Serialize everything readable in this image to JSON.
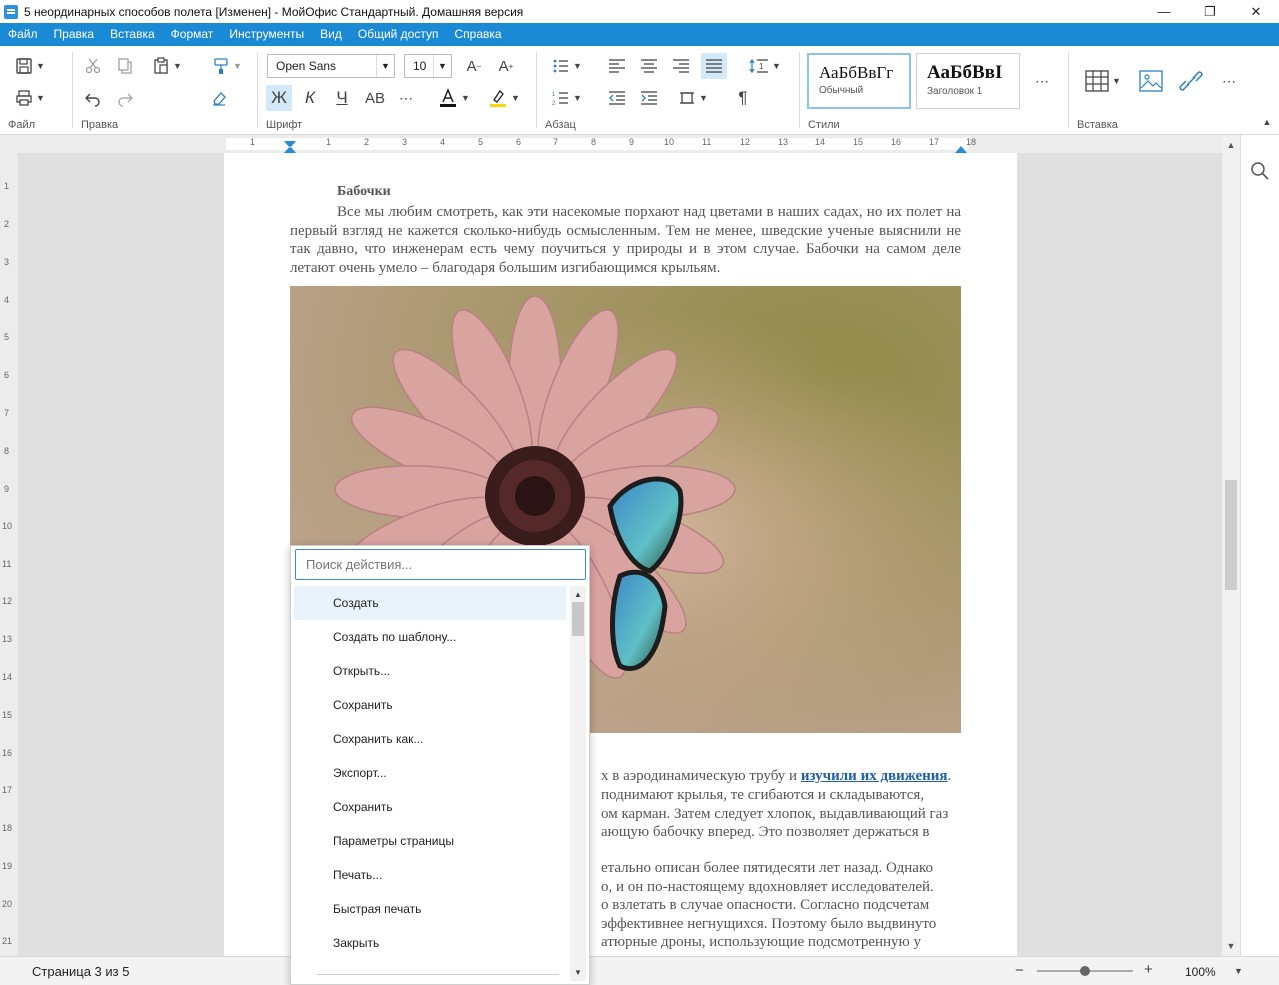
{
  "window": {
    "title": "5 неординарных способов полета [Изменен] - МойОфис Стандартный. Домашняя версия"
  },
  "menu": [
    "Файл",
    "Правка",
    "Вставка",
    "Формат",
    "Инструменты",
    "Вид",
    "Общий доступ",
    "Справка"
  ],
  "ribbon": {
    "groups": {
      "file": "Файл",
      "edit": "Правка",
      "font": "Шрифт",
      "paragraph": "Абзац",
      "styles": "Стили",
      "insert": "Вставка"
    },
    "font_name": "Open Sans",
    "font_size": "10",
    "format_buttons": {
      "bold": "Ж",
      "italic": "К",
      "underline": "Ч",
      "caps": "AB"
    },
    "styles": [
      {
        "preview": "АаБбВвГг",
        "name": "Обычный"
      },
      {
        "preview": "АаБбВвІ",
        "name": "Заголовок 1"
      }
    ],
    "colors": {
      "font_color": "#111111",
      "highlight_color": "#f5d90a",
      "accent": "#1a8ad4"
    }
  },
  "ruler": {
    "h_ticks": [
      "1",
      "1",
      "2",
      "3",
      "4",
      "5",
      "6",
      "7",
      "8",
      "9",
      "10",
      "11",
      "12",
      "13",
      "14",
      "15",
      "16",
      "17",
      "18"
    ],
    "v_ticks": [
      "1",
      "2",
      "3",
      "4",
      "5",
      "6",
      "7",
      "8",
      "9",
      "10",
      "11",
      "12",
      "13",
      "14",
      "15",
      "16",
      "17",
      "18",
      "19",
      "20",
      "21"
    ]
  },
  "document": {
    "heading": "Бабочки",
    "paragraph1": "Все мы любим смотреть, как эти насекомые порхают над цветами в наших садах, но их полет на первый взгляд не кажется сколько-нибудь осмысленным. Тем не менее, шведские ученые выяснили не так давно, что инженерам есть чему поучиться у природы и в этом случае. Бабочки на самом деле летают очень умело – благодаря большим изгибающимся крыльям.",
    "frag1_a": "х в аэродинамическую трубу и ",
    "frag1_link": "изучили их движения",
    "frag1_b": ".",
    "frag2": "поднимают крылья, те сгибаются и складываются,",
    "frag3": "ом карман. Затем следует хлопок, выдавливающий газ",
    "frag4": "ающую бабочку вперед. Это позволяет держаться в",
    "frag5": "етально описан более пятидесяти лет назад. Однако",
    "frag6": "о, и он по-настоящему вдохновляет исследователей.",
    "frag7": "о взлетать в случае опасности. Согласно подсчетам",
    "frag8": "эффективнее негнущихся. Поэтому было выдвинуто",
    "frag9": "атюрные дроны, использующие подсмотренную у"
  },
  "popup": {
    "search_placeholder": "Поиск действия...",
    "items": [
      "Создать",
      "Создать по шаблону...",
      "Открыть...",
      "Сохранить",
      "Сохранить как...",
      "Экспорт...",
      "Сохранить",
      "Параметры страницы",
      "Печать...",
      "Быстрая печать",
      "Закрыть"
    ]
  },
  "status": {
    "page_info": "Страница 3 из 5",
    "zoom": "100%",
    "zoom_level_percent": 100
  }
}
